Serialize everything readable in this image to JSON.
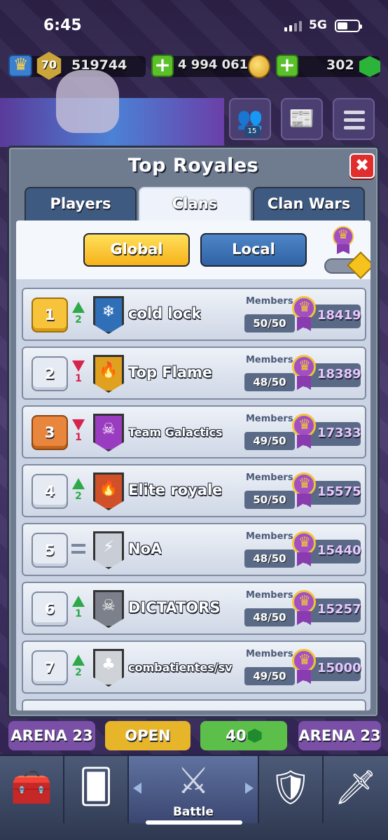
{
  "status_bar": {
    "time": "6:45",
    "network": "5G"
  },
  "resources": {
    "level": "70",
    "trophies": "519744",
    "gold": "4 994 061",
    "gems": "302",
    "plus_label": "+"
  },
  "top_buttons": {
    "friends_count": "15"
  },
  "modal": {
    "title": "Top Royales",
    "close_label": "✖",
    "tabs": [
      {
        "label": "Players"
      },
      {
        "label": "Clans"
      },
      {
        "label": "Clan Wars"
      }
    ],
    "filters": {
      "global": "Global",
      "local": "Local"
    }
  },
  "clans": [
    {
      "rank": "1",
      "trend": "up",
      "change": "2",
      "name": "cold lock",
      "members_label": "Members",
      "members": "50/50",
      "trophies": "18419",
      "badge_color": "#2f6fb8",
      "badge_glyph": "❄"
    },
    {
      "rank": "2",
      "trend": "down",
      "change": "1",
      "name": "Top Flame",
      "members_label": "Members",
      "members": "48/50",
      "trophies": "18389",
      "badge_color": "#e0a020",
      "badge_glyph": "🔥"
    },
    {
      "rank": "3",
      "trend": "down",
      "change": "1",
      "name": "Team Galactics",
      "members_label": "Members",
      "members": "49/50",
      "trophies": "17333",
      "badge_color": "#9a3cc0",
      "badge_glyph": "☠"
    },
    {
      "rank": "4",
      "trend": "up",
      "change": "2",
      "name": "Elite royale",
      "members_label": "Members",
      "members": "50/50",
      "trophies": "15575",
      "badge_color": "#d0502a",
      "badge_glyph": "🔥"
    },
    {
      "rank": "5",
      "trend": "same",
      "change": "",
      "name": "NoA",
      "members_label": "Members",
      "members": "48/50",
      "trophies": "15440",
      "badge_color": "#c9ced6",
      "badge_glyph": "⚡"
    },
    {
      "rank": "6",
      "trend": "up",
      "change": "1",
      "name": "DICTATORS",
      "members_label": "Members",
      "members": "48/50",
      "trophies": "15257",
      "badge_color": "#7c808a",
      "badge_glyph": "☠"
    },
    {
      "rank": "7",
      "trend": "up",
      "change": "2",
      "name": "combatientes/sv",
      "members_label": "Members",
      "members": "49/50",
      "trophies": "15000",
      "badge_color": "#cfd3d8",
      "badge_glyph": "♣"
    }
  ],
  "chests": [
    {
      "label": "ARENA 23"
    },
    {
      "label": "OPEN"
    },
    {
      "label": "40"
    },
    {
      "label": "ARENA 23"
    }
  ],
  "nav": {
    "battle_label": "Battle"
  }
}
